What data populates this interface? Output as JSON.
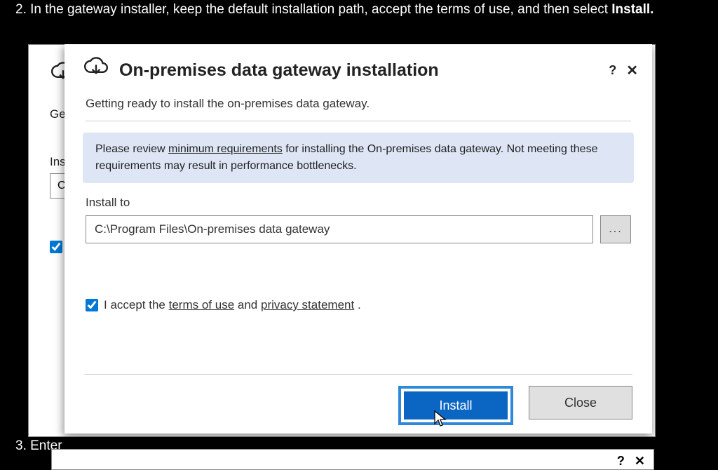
{
  "step2_prefix": "2. In the gateway installer, keep the default installation path, accept the terms of use, and then select ",
  "step2_bold": "Install.",
  "step3_text": "3. Enter",
  "back_window": {
    "getting_ready_partial": "Ge",
    "install_label": "Ins",
    "input_value_partial": "C"
  },
  "dialog": {
    "title": "On-premises data gateway installation",
    "help_symbol": "?",
    "close_symbol": "✕",
    "subheader": "Getting ready to install the on-premises data gateway.",
    "banner_pre": "Please review ",
    "banner_link": "minimum requirements",
    "banner_post": " for installing the On-premises data gateway. Not meeting these requirements may result in performance bottlenecks.",
    "install_to_label": "Install to",
    "install_path": "C:\\Program Files\\On-premises data gateway",
    "browse_label": "...",
    "accept_pre": "I accept the ",
    "accept_terms_link": "terms of use",
    "accept_mid": " and ",
    "accept_privacy_link": "privacy statement",
    "accept_suffix": " .",
    "install_btn": "Install",
    "close_btn": "Close"
  }
}
